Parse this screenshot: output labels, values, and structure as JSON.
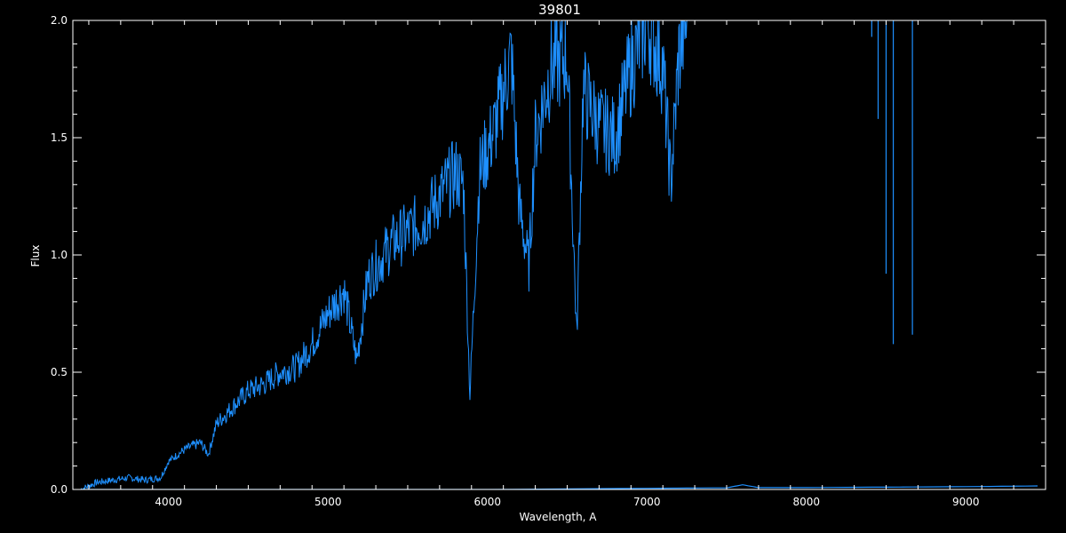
{
  "chart_data": {
    "type": "line",
    "title": "39801",
    "xlabel": "Wavelength, A",
    "ylabel": "Flux",
    "xlim": [
      3400,
      9500
    ],
    "ylim": [
      0.0,
      2.0
    ],
    "x_ticks": [
      4000,
      5000,
      6000,
      7000,
      8000,
      9000
    ],
    "x_tick_labels": [
      "4000",
      "5000",
      "6000",
      "7000",
      "8000",
      "9000"
    ],
    "y_ticks": [
      0.0,
      0.5,
      1.0,
      1.5,
      2.0
    ],
    "y_tick_labels": [
      "0.0",
      "0.5",
      "1.0",
      "1.5",
      "2.0"
    ],
    "grid": false,
    "colors": {
      "background": "#000000",
      "axes": "#ffffff",
      "series": "#1e90ff"
    },
    "series": [
      {
        "x": [
          3450,
          3550,
          3650,
          3750,
          3850,
          3950,
          4000,
          4100,
          4200,
          4250,
          4300,
          4400,
          4500,
          4600,
          4700,
          4800,
          4900,
          5000,
          5100,
          5180,
          5250,
          5400,
          5500,
          5600,
          5700,
          5800,
          5850,
          5890,
          5950,
          6050,
          6150,
          6200,
          6260,
          6300,
          6400,
          6500,
          6560,
          6600,
          6700,
          6800,
          6900,
          7000,
          7100,
          7150,
          7200,
          7250
        ],
        "y": [
          0.0,
          0.03,
          0.04,
          0.05,
          0.04,
          0.05,
          0.12,
          0.17,
          0.2,
          0.15,
          0.28,
          0.35,
          0.42,
          0.45,
          0.5,
          0.52,
          0.62,
          0.75,
          0.85,
          0.55,
          0.9,
          1.05,
          1.1,
          1.15,
          1.25,
          1.35,
          1.3,
          0.4,
          1.35,
          1.55,
          1.85,
          1.2,
          0.95,
          1.5,
          1.8,
          1.85,
          0.65,
          1.7,
          1.55,
          1.5,
          1.8,
          2.0,
          1.8,
          1.3,
          1.85,
          2.0
        ]
      },
      {
        "x": [
          3450,
          4000,
          5000,
          6000,
          7000,
          7500,
          7600,
          7700,
          8000,
          8500,
          9000,
          9450
        ],
        "y": [
          0.0,
          0.0,
          0.0,
          0.0,
          0.005,
          0.007,
          0.02,
          0.008,
          0.008,
          0.01,
          0.012,
          0.015
        ]
      }
    ],
    "annotations": [
      {
        "x": 8410,
        "y_top": 2.0,
        "y_bottom": 1.93
      },
      {
        "x": 8450,
        "y_top": 2.0,
        "y_bottom": 1.58
      },
      {
        "x": 8500,
        "y_top": 2.0,
        "y_bottom": 0.92
      },
      {
        "x": 8545,
        "y_top": 2.0,
        "y_bottom": 0.62
      },
      {
        "x": 8665,
        "y_top": 2.0,
        "y_bottom": 0.66
      }
    ]
  }
}
